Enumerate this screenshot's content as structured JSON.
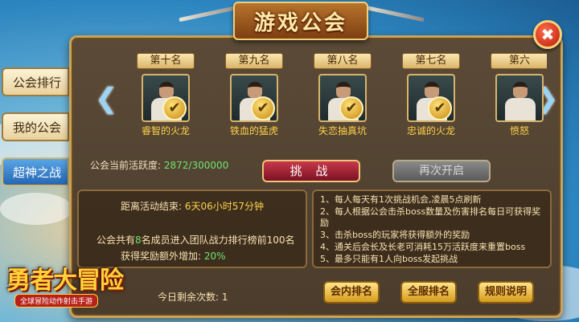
{
  "title": "游戏公会",
  "close_icon": "✖",
  "tabs": [
    {
      "label": "公会排行",
      "active": false
    },
    {
      "label": "我的公会",
      "active": false
    },
    {
      "label": "超神之战",
      "active": true
    }
  ],
  "ranking": [
    {
      "rank": "第十名",
      "guild": "睿智的火龙"
    },
    {
      "rank": "第九名",
      "guild": "铁血的猛虎"
    },
    {
      "rank": "第八名",
      "guild": "失恋抽真坑"
    },
    {
      "rank": "第七名",
      "guild": "忠诚的火龙"
    },
    {
      "rank": "第六",
      "guild": "愤怒"
    }
  ],
  "check_glyph": "✔",
  "nav": {
    "left_arrow": "❮",
    "right_arrow": "❯"
  },
  "activity": {
    "label": "公会当前活跃度:",
    "current": "2872",
    "separator": "/",
    "max": "300000"
  },
  "buttons": {
    "challenge": "挑 战",
    "restart": "再次开启",
    "guild_rank": "会内排名",
    "server_rank": "全服排名",
    "rules": "规则说明"
  },
  "countdown": {
    "label": "距离活动结束:",
    "value": "6天06小时57分钟"
  },
  "members": {
    "prefix": "公会共有",
    "count": "8",
    "suffix": "名成员进入团队战力排行榜前100名"
  },
  "bonus": {
    "label": "获得奖励额外增加:",
    "value": "20%"
  },
  "rules": [
    "1、每人每天有1次挑战机会,凌晨5点刷新",
    "2、每人根据公会击杀boss数量及伤害排名每日可获得奖励",
    "3、击杀boss的玩家将获得额外的奖励",
    "4、通关后会长及长老可消耗15万活跃度来重置boss",
    "5、最多只能有1人向boss发起挑战"
  ],
  "remaining": {
    "label": "今日剩余次数:",
    "value": "1"
  },
  "logo": {
    "main": "勇者大冒险",
    "sub": "全球冒险动作射击手游"
  }
}
